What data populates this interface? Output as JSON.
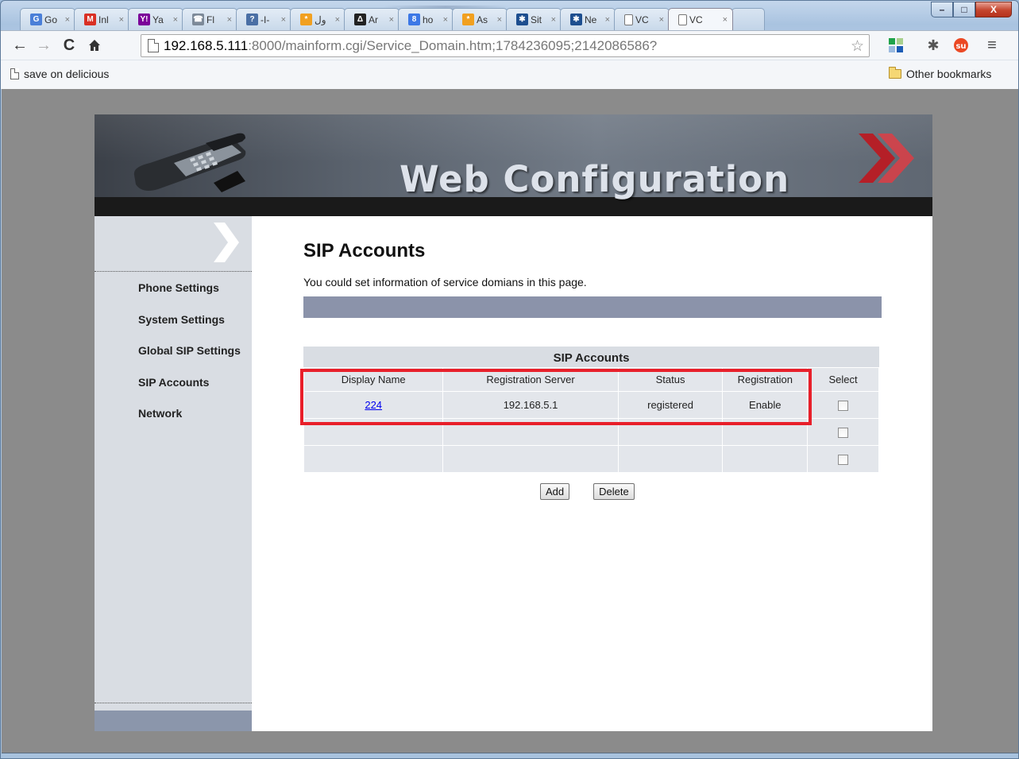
{
  "browser": {
    "tabs": [
      {
        "label": "Go",
        "icon_color": "#4a7fd8",
        "icon_glyph": "G"
      },
      {
        "label": "Inl",
        "icon_color": "#d93025",
        "icon_glyph": "M"
      },
      {
        "label": "Ya",
        "icon_color": "#7b0099",
        "icon_glyph": "Y!"
      },
      {
        "label": "Fl",
        "icon_color": "#7d8a99",
        "icon_glyph": "☎"
      },
      {
        "label": "-I-",
        "icon_color": "#4a6fa5",
        "icon_glyph": "?"
      },
      {
        "label": "ول",
        "icon_color": "#f1a020",
        "icon_glyph": "*"
      },
      {
        "label": "Ar",
        "icon_color": "#222222",
        "icon_glyph": "Δ"
      },
      {
        "label": "ho",
        "icon_color": "#3c78e6",
        "icon_glyph": "8"
      },
      {
        "label": "As",
        "icon_color": "#f1a020",
        "icon_glyph": "*"
      },
      {
        "label": "Sit",
        "icon_color": "#1d4e8f",
        "icon_glyph": "✱"
      },
      {
        "label": "Ne",
        "icon_color": "#1d4e8f",
        "icon_glyph": "✱"
      },
      {
        "label": "VC",
        "icon_color": "",
        "icon_glyph": ""
      },
      {
        "label": "VC",
        "icon_color": "",
        "icon_glyph": "",
        "active": true
      }
    ],
    "tab_close": "×",
    "url_host": "192.168.5.111",
    "url_rest": ":8000/mainform.cgi/Service_Domain.htm;1784236095;2142086586?",
    "bookmarks": {
      "left": "save on delicious",
      "right": "Other bookmarks"
    },
    "window_controls": {
      "minimize": "–",
      "maximize": "□",
      "close": "X"
    }
  },
  "banner": {
    "title": "Web Configuration"
  },
  "sidebar": {
    "items": [
      {
        "label": "Phone Settings"
      },
      {
        "label": "System Settings"
      },
      {
        "label": "Global SIP Settings"
      },
      {
        "label": "SIP Accounts"
      },
      {
        "label": "Network"
      }
    ]
  },
  "main": {
    "title": "SIP Accounts",
    "description": "You could set information of service domians in this page.",
    "table": {
      "caption": "SIP Accounts",
      "headers": [
        "Display Name",
        "Registration Server",
        "Status",
        "Registration",
        "Select"
      ],
      "rows": [
        {
          "display_name": "224",
          "server": "192.168.5.1",
          "status": "registered",
          "registration": "Enable"
        },
        {
          "display_name": "",
          "server": "",
          "status": "",
          "registration": ""
        },
        {
          "display_name": "",
          "server": "",
          "status": "",
          "registration": ""
        }
      ]
    },
    "buttons": {
      "add": "Add",
      "delete": "Delete"
    }
  },
  "colors": {
    "highlight": "#e81f2a",
    "sidebar_bg": "#d9dde3",
    "info_bar": "#8b93aa",
    "banner_accent": "#c4232a"
  }
}
